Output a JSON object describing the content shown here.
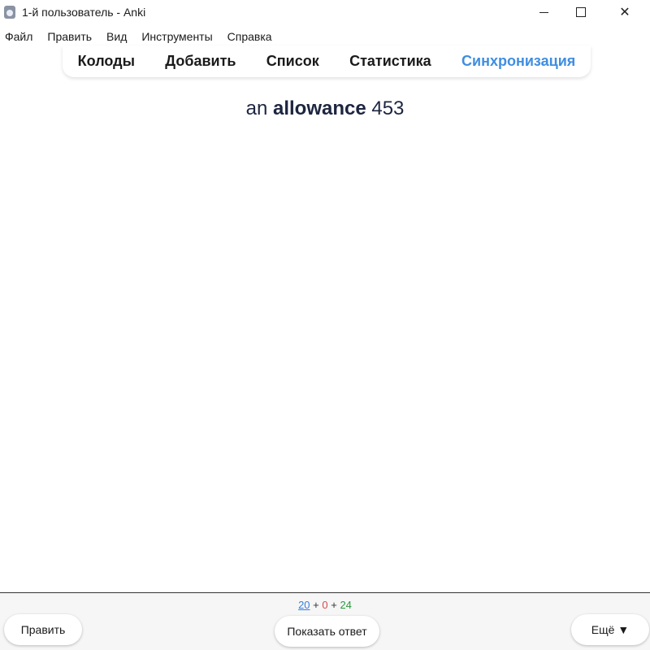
{
  "window": {
    "title": "1-й пользователь - Anki"
  },
  "menu": {
    "items": [
      "Файл",
      "Править",
      "Вид",
      "Инструменты",
      "Справка"
    ]
  },
  "nav": {
    "decks": "Колоды",
    "add": "Добавить",
    "browse": "Список",
    "stats": "Статистика",
    "sync": "Синхронизация",
    "sync_color": "#3f8ee0"
  },
  "card": {
    "prefix": "an",
    "word": "allowance",
    "number": "453"
  },
  "counts": {
    "new": "20",
    "learn": "0",
    "review": "24",
    "sep1": "+",
    "sep2": "+"
  },
  "buttons": {
    "edit": "Править",
    "show_answer": "Показать ответ",
    "more": "Ещё ▼"
  },
  "icons": {
    "app": "anki-icon",
    "minimize": "minimize-icon",
    "maximize": "maximize-icon",
    "close": "close-icon"
  }
}
